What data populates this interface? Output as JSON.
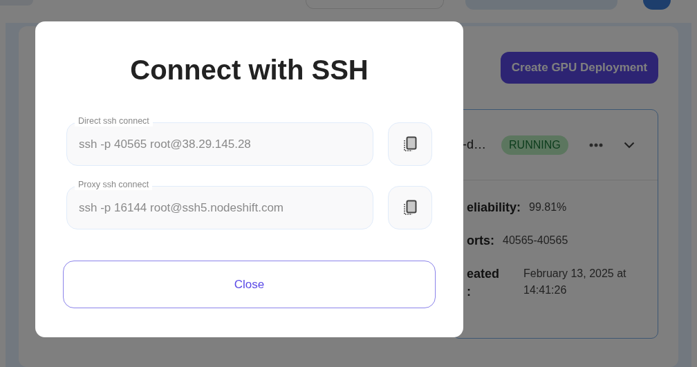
{
  "page": {
    "create_button": "Create GPU Deployment",
    "deployment": {
      "name": "-d…",
      "status": "RUNNING",
      "details": [
        {
          "label_lines": [
            "eliability:"
          ],
          "value": "99.81%"
        },
        {
          "label_lines": [
            "orts:"
          ],
          "value": "40565-40565"
        },
        {
          "label_lines": [
            "eated",
            ":"
          ],
          "value": "February 13, 2025 at 14:41:26"
        }
      ]
    }
  },
  "modal": {
    "title": "Connect with SSH",
    "fields": [
      {
        "label": "Direct ssh connect",
        "value": "ssh -p 40565 root@38.29.145.28"
      },
      {
        "label": "Proxy ssh connect",
        "value": "ssh -p 16144 root@ssh5.nodeshift.com"
      }
    ],
    "close_button": "Close"
  }
}
